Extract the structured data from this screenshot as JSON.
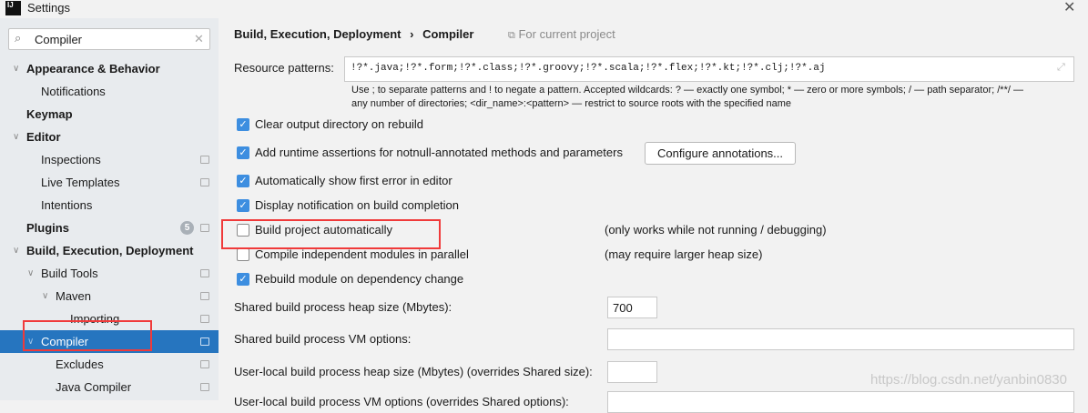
{
  "window": {
    "title": "Settings",
    "logo": "IJ",
    "close_icon": "close-icon"
  },
  "search": {
    "value": "Compiler"
  },
  "sidebar": {
    "items": [
      {
        "label": "Appearance & Behavior",
        "level": 0,
        "bold": true,
        "expanded": true
      },
      {
        "label": "Notifications",
        "level": 1
      },
      {
        "label": "Keymap",
        "level": 0,
        "bold": true
      },
      {
        "label": "Editor",
        "level": 0,
        "bold": true,
        "expanded": true
      },
      {
        "label": "Inspections",
        "level": 1,
        "copy": true
      },
      {
        "label": "Live Templates",
        "level": 1,
        "copy": true
      },
      {
        "label": "Intentions",
        "level": 1
      },
      {
        "label": "Plugins",
        "level": 0,
        "bold": true,
        "copy": true,
        "badge": "5"
      },
      {
        "label": "Build, Execution, Deployment",
        "level": 0,
        "bold": true,
        "expanded": true
      },
      {
        "label": "Build Tools",
        "level": 1,
        "copy": true,
        "expanded": true
      },
      {
        "label": "Maven",
        "level": 2,
        "copy": true,
        "expanded": true
      },
      {
        "label": "Importing",
        "level": 3,
        "copy": true
      },
      {
        "label": "Compiler",
        "level": 1,
        "copy": true,
        "expanded": true,
        "selected": true
      },
      {
        "label": "Excludes",
        "level": 2,
        "copy": true
      },
      {
        "label": "Java Compiler",
        "level": 2,
        "copy": true
      }
    ]
  },
  "breadcrumb": {
    "parent": "Build, Execution, Deployment",
    "separator": "›",
    "current": "Compiler",
    "scope": "For current project"
  },
  "resource": {
    "label": "Resource patterns:",
    "value": "!?*.java;!?*.form;!?*.class;!?*.groovy;!?*.scala;!?*.flex;!?*.kt;!?*.clj;!?*.aj",
    "help1": "Use ; to separate patterns and ! to negate a pattern. Accepted wildcards: ? — exactly one symbol; * — zero or more symbols; / — path separator; /**/ —",
    "help2": "any number of directories; <dir_name>:<pattern> — restrict to source roots with the specified name"
  },
  "options": [
    {
      "label": "Clear output directory on rebuild",
      "checked": true
    },
    {
      "label": "Add runtime assertions for notnull-annotated methods and parameters",
      "checked": true
    },
    {
      "label": "Automatically show first error in editor",
      "checked": true
    },
    {
      "label": "Display notification on build completion",
      "checked": true
    },
    {
      "label": "Build project automatically",
      "checked": false,
      "note": "(only works while not running / debugging)"
    },
    {
      "label": "Compile independent modules in parallel",
      "checked": false,
      "note": "(may require larger heap size)"
    },
    {
      "label": "Rebuild module on dependency change",
      "checked": true
    }
  ],
  "configure_button": "Configure annotations...",
  "fields": [
    {
      "label": "Shared build process heap size (Mbytes):",
      "value": "700"
    },
    {
      "label": "Shared build process VM options:",
      "value": ""
    },
    {
      "label": "User-local build process heap size (Mbytes) (overrides Shared size):",
      "value": ""
    },
    {
      "label": "User-local build process VM options (overrides Shared options):",
      "value": ""
    }
  ],
  "watermark": "https://blog.csdn.net/yanbin0830"
}
